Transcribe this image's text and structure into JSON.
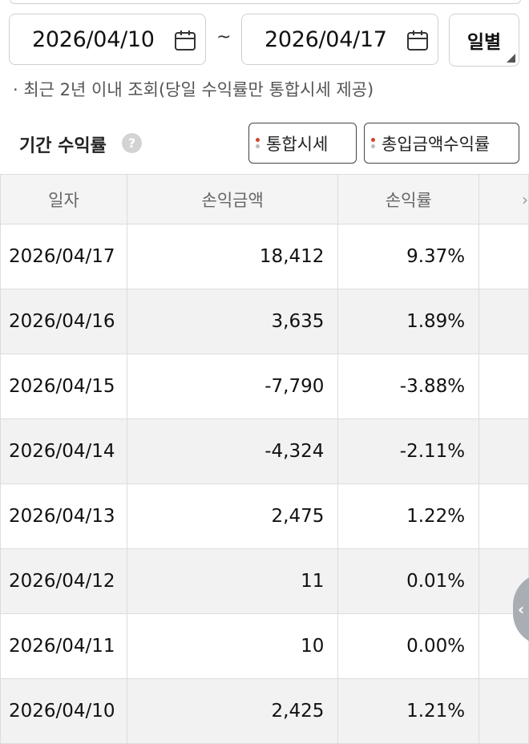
{
  "filter": {
    "date_from": "2026/04/10",
    "date_to": "2026/04/17",
    "range_separator": "~",
    "period_label": "일별",
    "calendar_icon": "calendar-icon"
  },
  "notice": "· 최근 2년 이내 조회(당일 수익률만 통합시세 제공)",
  "section": {
    "title": "기간 수익률",
    "help_symbol": "?",
    "tags": [
      "통합시세",
      "총입금액수익률"
    ]
  },
  "table": {
    "headers": [
      "일자",
      "손익금액",
      "손익률"
    ],
    "more_symbol": "›",
    "rows": [
      {
        "date": "2026/04/17",
        "amount": "18,412",
        "rate": "9.37%"
      },
      {
        "date": "2026/04/16",
        "amount": "3,635",
        "rate": "1.89%"
      },
      {
        "date": "2026/04/15",
        "amount": "-7,790",
        "rate": "-3.88%"
      },
      {
        "date": "2026/04/14",
        "amount": "-4,324",
        "rate": "-2.11%"
      },
      {
        "date": "2026/04/13",
        "amount": "2,475",
        "rate": "1.22%"
      },
      {
        "date": "2026/04/12",
        "amount": "11",
        "rate": "0.01%"
      },
      {
        "date": "2026/04/11",
        "amount": "10",
        "rate": "0.00%"
      },
      {
        "date": "2026/04/10",
        "amount": "2,425",
        "rate": "1.21%"
      }
    ]
  },
  "side_handle_symbol": "‹",
  "colors": {
    "tag_dot_accent": "#d2452e",
    "row_alt": "#f2f2f2",
    "handle": "#a9aeb5"
  }
}
